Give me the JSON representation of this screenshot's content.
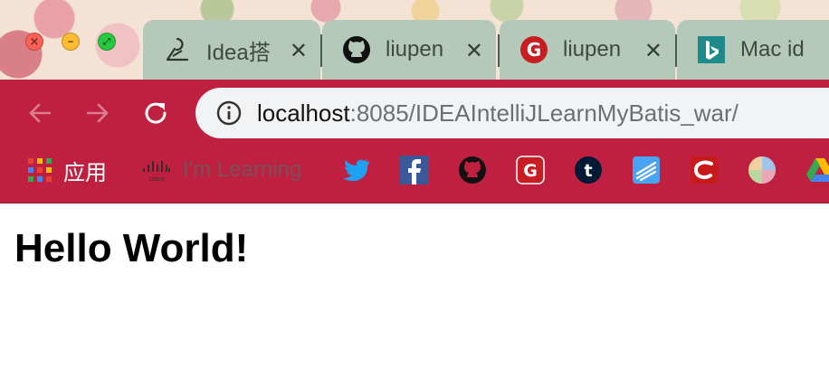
{
  "tabs": [
    {
      "title": "Idea搭",
      "favicon": "idea-blog-icon"
    },
    {
      "title": "liupen",
      "favicon": "github-icon"
    },
    {
      "title": "liupen",
      "favicon": "gitee-icon"
    },
    {
      "title": "Mac id",
      "favicon": "bing-icon"
    }
  ],
  "tab_close_glyph": "✕",
  "omnibox": {
    "host": "localhost",
    "rest": ":8085/IDEAIntelliJLearnMyBatis_war/"
  },
  "bookmarks": {
    "apps_label": "应用",
    "cisco_label": "I'm Learning",
    "icons": [
      "twitter-icon",
      "facebook-icon",
      "github-icon",
      "gitee-icon",
      "tumblr-icon",
      "notes-icon",
      "csdn-icon",
      "colorful-ball-icon",
      "google-drive-icon"
    ]
  },
  "page": {
    "heading": "Hello World!"
  },
  "colors": {
    "toolbar": "#c02040",
    "tab": "#b4c9b9",
    "omnibox": "#f1f3f4"
  }
}
